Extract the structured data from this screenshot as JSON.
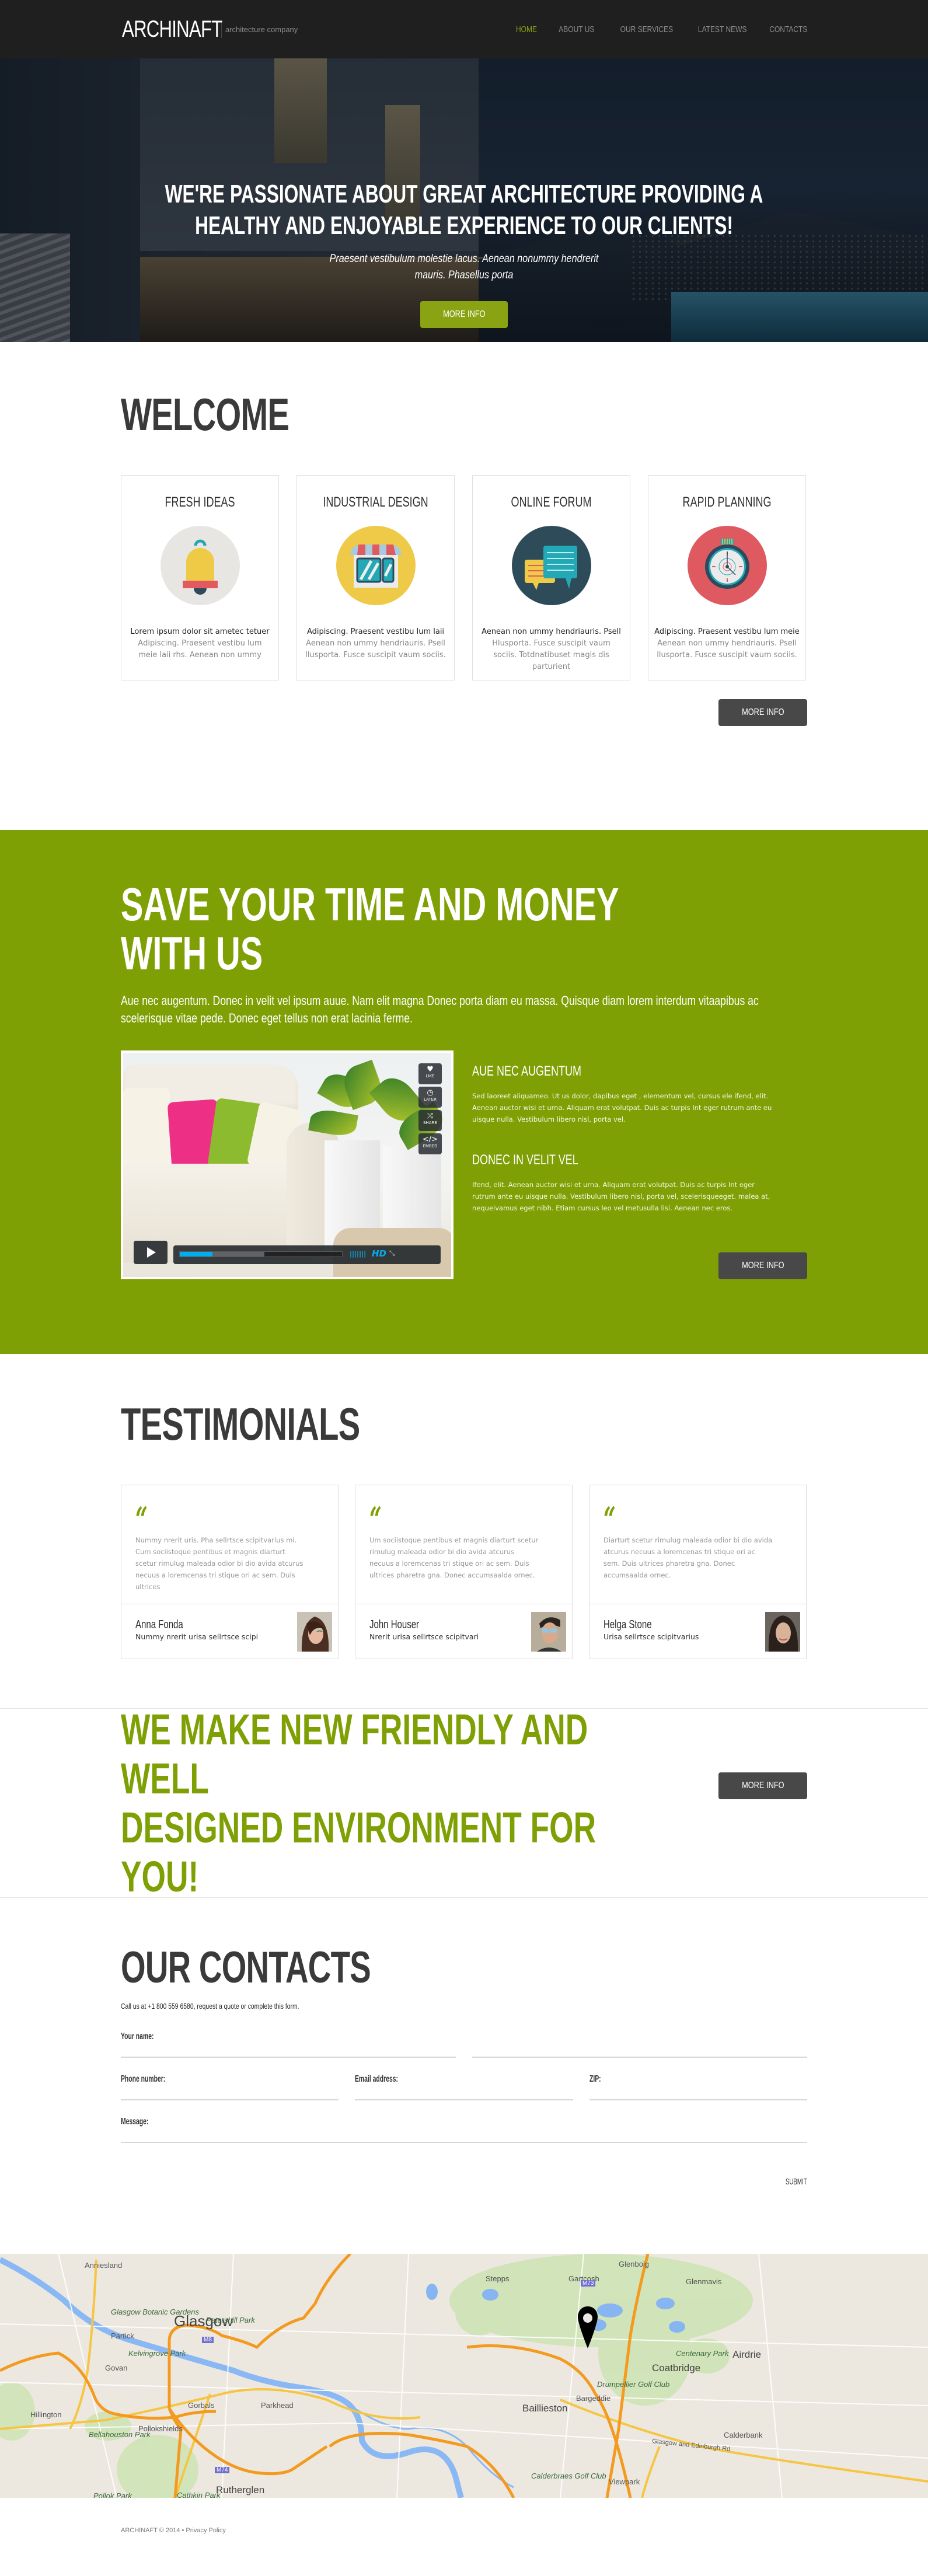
{
  "header": {
    "logo": "ARCHINAFT",
    "slogan": "architecture company",
    "nav": [
      {
        "label": "HOME",
        "active": true
      },
      {
        "label": "ABOUT US",
        "active": false
      },
      {
        "label": "OUR SERVICES",
        "active": false
      },
      {
        "label": "LATEST NEWS",
        "active": false
      },
      {
        "label": "CONTACTS",
        "active": false
      }
    ]
  },
  "hero": {
    "title": "WE'RE PASSIONATE ABOUT GREAT  ARCHITECTURE PROVIDING A HEALTHY AND ENJOYABLE EXPERIENCE TO OUR CLIENTS!",
    "subtitle_line1": "Praesent vestibulum molestie lacus. Aenean nonummy hendrerit",
    "subtitle_line2": "mauris. Phasellus porta",
    "button": "MORE INFO"
  },
  "welcome": {
    "title": "WELCOME",
    "features": [
      {
        "title": "FRESH IDEAS",
        "icon": "bell-icon",
        "line1": "Lorem ipsum dolor sit ametec tetuer",
        "rest": "Adipiscing. Praesent vestibu lum meie laii rhs. Aenean non ummy"
      },
      {
        "title": "INDUSTRIAL DESIGN",
        "icon": "storefront-icon",
        "line1": "Adipiscing. Praesent vestibu lum  laii",
        "rest": "Aenean non ummy hendriauris. Psell llusporta. Fusce suscipit vaum sociis."
      },
      {
        "title": "ONLINE FORUM",
        "icon": "chat-bubbles-icon",
        "line1": "Aenean non ummy hendriauris. Psell",
        "rest": "Hlusporta. Fusce suscipit vaum sociis. Totdnatibuset magis dis parturient"
      },
      {
        "title": "RAPID PLANNING",
        "icon": "stopwatch-icon",
        "line1": "Adipiscing. Praesent vestibu lum meie",
        "rest": "Aenean non ummy hendriauris. Psell llusporta. Fusce suscipit vaum sociis."
      }
    ],
    "button": "MORE INFO"
  },
  "save": {
    "title_line1": "SAVE YOUR TIME AND MONEY",
    "title_line2": "WITH US",
    "intro": "Aue nec augentum. Donec in velit vel ipsum auue. Nam elit magna Donec porta diam eu massa. Quisque diam lorem interdum vitaapibus ac scelerisque vitae pede. Donec eget tellus non erat lacinia ferme.",
    "video": {
      "side_buttons": [
        {
          "label": "LIKE",
          "icon": "heart-icon"
        },
        {
          "label": "LATER",
          "icon": "clock-icon"
        },
        {
          "label": "SHARE",
          "icon": "share-icon"
        },
        {
          "label": "EMBED",
          "icon": "embed-icon"
        }
      ],
      "played_fraction": 0.2,
      "loaded_fraction": 0.52,
      "hd_label": "HD"
    },
    "block1_title": "AUE NEC AUGENTUM",
    "block1_text": "Sed laoreet aliquameo.  Ut us dolor, dapibus eget , elementum vel, cursus ele ifend, elit. Aenean auctor wisi et urna. Aliquam erat volutpat. Duis ac turpis Int eger rutrum ante eu uisque nulla.  Vestibulum libero nisl, porta vel.",
    "block2_title": "DONEC IN VELIT VEL",
    "block2_text": "Ifend, elit. Aenean auctor wisi et urna. Aliquam erat volutpat. Duis ac turpis Int eger rutrum ante eu uisque nulla.  Vestibulum libero nisl, porta vel, scelerisqueeget. malea at, nequeivamus eget nibh.  Etiam cursus leo vel metusulla lisi.  Aenean nec eros.",
    "button": "MORE INFO"
  },
  "testimonials": {
    "title": "TESTIMONIALS",
    "items": [
      {
        "text": "Nummy nrerit uris. Pha sellrtsce scipitvarius mi. Cum sociistoque pentibus et magnis diarturt scetur rimulug maleada odior bi dio avida atcurus necuus a loremcenas tri stique ori ac sem. Duis ultrices",
        "name": "Anna Fonda",
        "role": "Nummy nrerit urisa sellrtsce scipi"
      },
      {
        "text": "Um sociistoque pentibus et magnis diarturt scetur rimulug maleada odior bi dio avida atcurus necuus a loremcenas tri stique ori ac sem. Duis ultrices pharetra gna. Donec accumsaalda ornec.",
        "name": "John Houser",
        "role": "Nrerit urisa sellrtsce scipitvari"
      },
      {
        "text": "Diarturt scetur rimulug maleada odior bi dio avida atcurus necuus a loremcenas tri stique ori ac sem. Duis ultrices pharetra gna. Donec accumsaalda ornec.",
        "name": "Helga Stone",
        "role": "Urisa sellrtsce scipitvarius"
      }
    ]
  },
  "cta": {
    "title_line1": "WE MAKE NEW  FRIENDLY AND WELL",
    "title_line2": "DESIGNED ENVIRONMENT FOR YOU!",
    "button": "MORE INFO"
  },
  "contacts": {
    "title": "OUR CONTACTS",
    "call_text": "Call us at +1 800 559 6580, request a quote or complete this form.",
    "fields": {
      "name": "Your name:",
      "phone": "Phone number:",
      "email": "Email address:",
      "zip": "ZIP:",
      "message": "Message:"
    },
    "submit": "SUBMIT"
  },
  "map": {
    "labels": {
      "glasgow": "Glasgow",
      "anniesland": "Anniesland",
      "botanic": "Glasgow Botanic Gardens",
      "partick": "Partick",
      "kelvingrove": "Kelvingrove Park",
      "govan": "Govan",
      "hillington": "Hillington",
      "bellahouston": "Bellahouston Park",
      "pollokshields": "Pollokshields",
      "pollok": "Pollok Park",
      "gorbals": "Gorbals",
      "petershill": "Petershill Park",
      "rutherglen": "Rutherglen",
      "cathkin": "Cathkin Park",
      "parkhead": "Parkhead",
      "stepps": "Stepps",
      "gartcosh": "Gartcosh",
      "glenboig": "Glenboig",
      "glenmavis": "Glenmavis",
      "baillieston": "Baillieston",
      "bargeddie": "Bargeddie",
      "drumpellier": "Drumpellier Golf Club",
      "coatbridge": "Coatbridge",
      "centenary": "Centenary Park",
      "airdrie": "Airdrie",
      "calderbank": "Calderbank",
      "calderbraes": "Calderbraes Golf Club",
      "viewpark": "Viewpark",
      "edinburgh_rd": "Glasgow and Edinburgh Rd",
      "m8": "M8",
      "m73": "M73",
      "m74": "M74"
    }
  },
  "footer": {
    "copyright": "ARCHINAFT © 2014 • Privacy Policy"
  },
  "colors": {
    "accent": "#7fa004",
    "dark_button": "#484848",
    "header_bg": "#1f1f1f"
  }
}
